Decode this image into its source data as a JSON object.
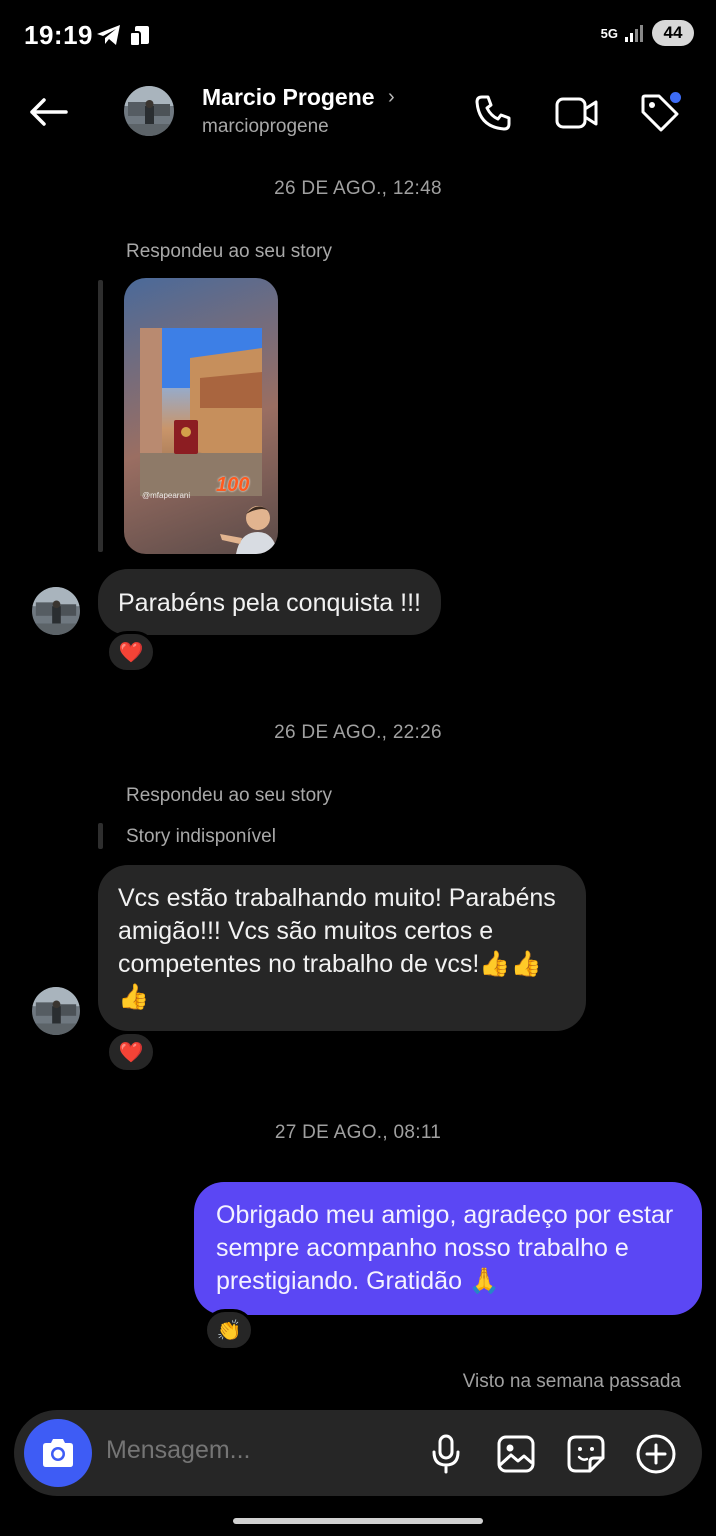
{
  "status_bar": {
    "time": "19:19",
    "network": "5G",
    "battery": "44"
  },
  "header": {
    "name": "Marcio Progene",
    "chevron": "›",
    "handle": "marcioprogene",
    "icons": [
      "back-arrow-icon",
      "phone-icon",
      "video-camera-icon",
      "tag-icon"
    ]
  },
  "messages": {
    "ts1": "26 DE AGO., 12:48",
    "reply1_label": "Respondeu ao seu story",
    "story_handle": "@mfapearani",
    "story_sticker": "100",
    "msg1": "Parabéns pela conquista !!!",
    "msg1_reaction": "❤️",
    "ts2": "26 DE AGO., 22:26",
    "reply2_label": "Respondeu ao seu story",
    "story_unavailable": "Story indisponível",
    "msg2": "Vcs estão trabalhando muito! Parabéns amigão!!! Vcs são muitos certos e competentes no trabalho de vcs!👍👍👍",
    "msg2_reaction": "❤️",
    "ts3": "27 DE AGO., 08:11",
    "msg3": "Obrigado meu amigo, agradeço por estar sempre acompanho nosso trabalho e prestigiando. Gratidão 🙏",
    "msg3_reaction": "👏",
    "seen": "Visto na semana passada"
  },
  "composer": {
    "placeholder": "Mensagem...",
    "icons": [
      "camera-icon",
      "microphone-icon",
      "gallery-icon",
      "sticker-icon",
      "plus-icon"
    ]
  },
  "colors": {
    "background": "#000000",
    "incoming_bubble": "#262626",
    "outgoing_bubble": "#5b47f4",
    "camera_button": "#3e5cf5",
    "notification_dot": "#3d6cf5"
  }
}
